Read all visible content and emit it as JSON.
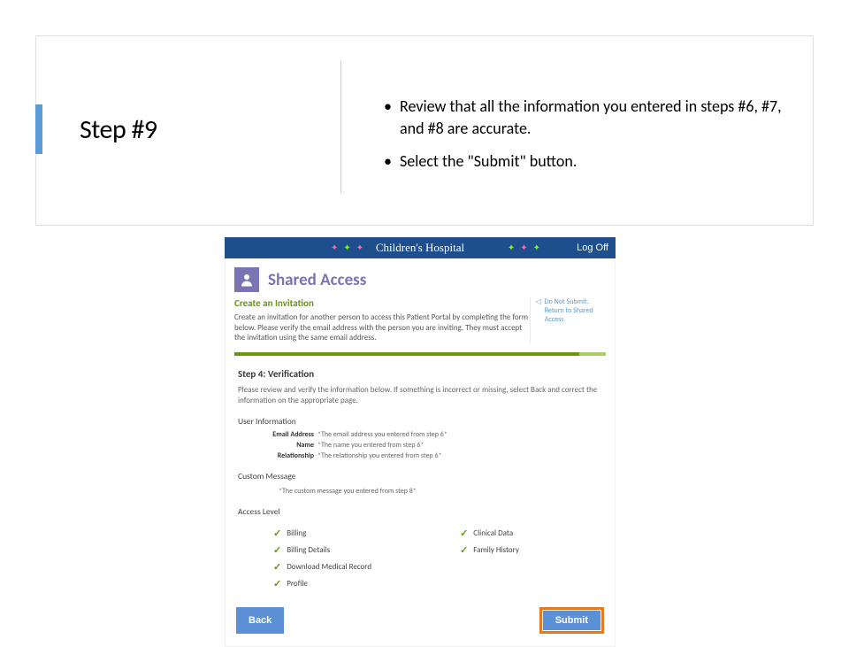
{
  "slide": {
    "title": "Step #9",
    "bullet1": "Review that all the information you entered in steps #6, #7, and #8 are accurate.",
    "bullet2": "Select the \"Submit\" button."
  },
  "portal": {
    "brand": "Children's Hospital",
    "logoff": "Log Off",
    "heading": "Shared Access",
    "createInvitation": "Create an Invitation",
    "intro": "Create an invitation for another person to access this Patient Portal by completing the form below. Please verify the email address with the person you are inviting. They must accept the invitation using the same email address.",
    "sidebar": {
      "doNotSubmit": "Do Not Submit.",
      "returnLine": "Return to Shared Access"
    },
    "stepLabel": "Step 4: Verification",
    "stepDesc": "Please review and verify the information below. If something is incorrect or missing, select Back and correct the information on the appropriate page.",
    "userInfoLabel": "User Information",
    "fields": {
      "emailLabel": "Email Address",
      "emailValue": "*The email address you entered from step 6*",
      "nameLabel": "Name",
      "nameValue": "*The name you entered from step 6*",
      "relLabel": "Relationship",
      "relValue": "*The relationship you entered from step 6*"
    },
    "customMessageLabel": "Custom Message",
    "customMessageValue": "*The custom message you entered from step 8*",
    "accessLevelLabel": "Access Level",
    "access": {
      "billing": "Billing",
      "billingDetails": "Billing Details",
      "download": "Download Medical Record",
      "profile": "Profile",
      "clinical": "Clinical Data",
      "family": "Family History"
    },
    "backBtn": "Back",
    "submitBtn": "Submit"
  }
}
